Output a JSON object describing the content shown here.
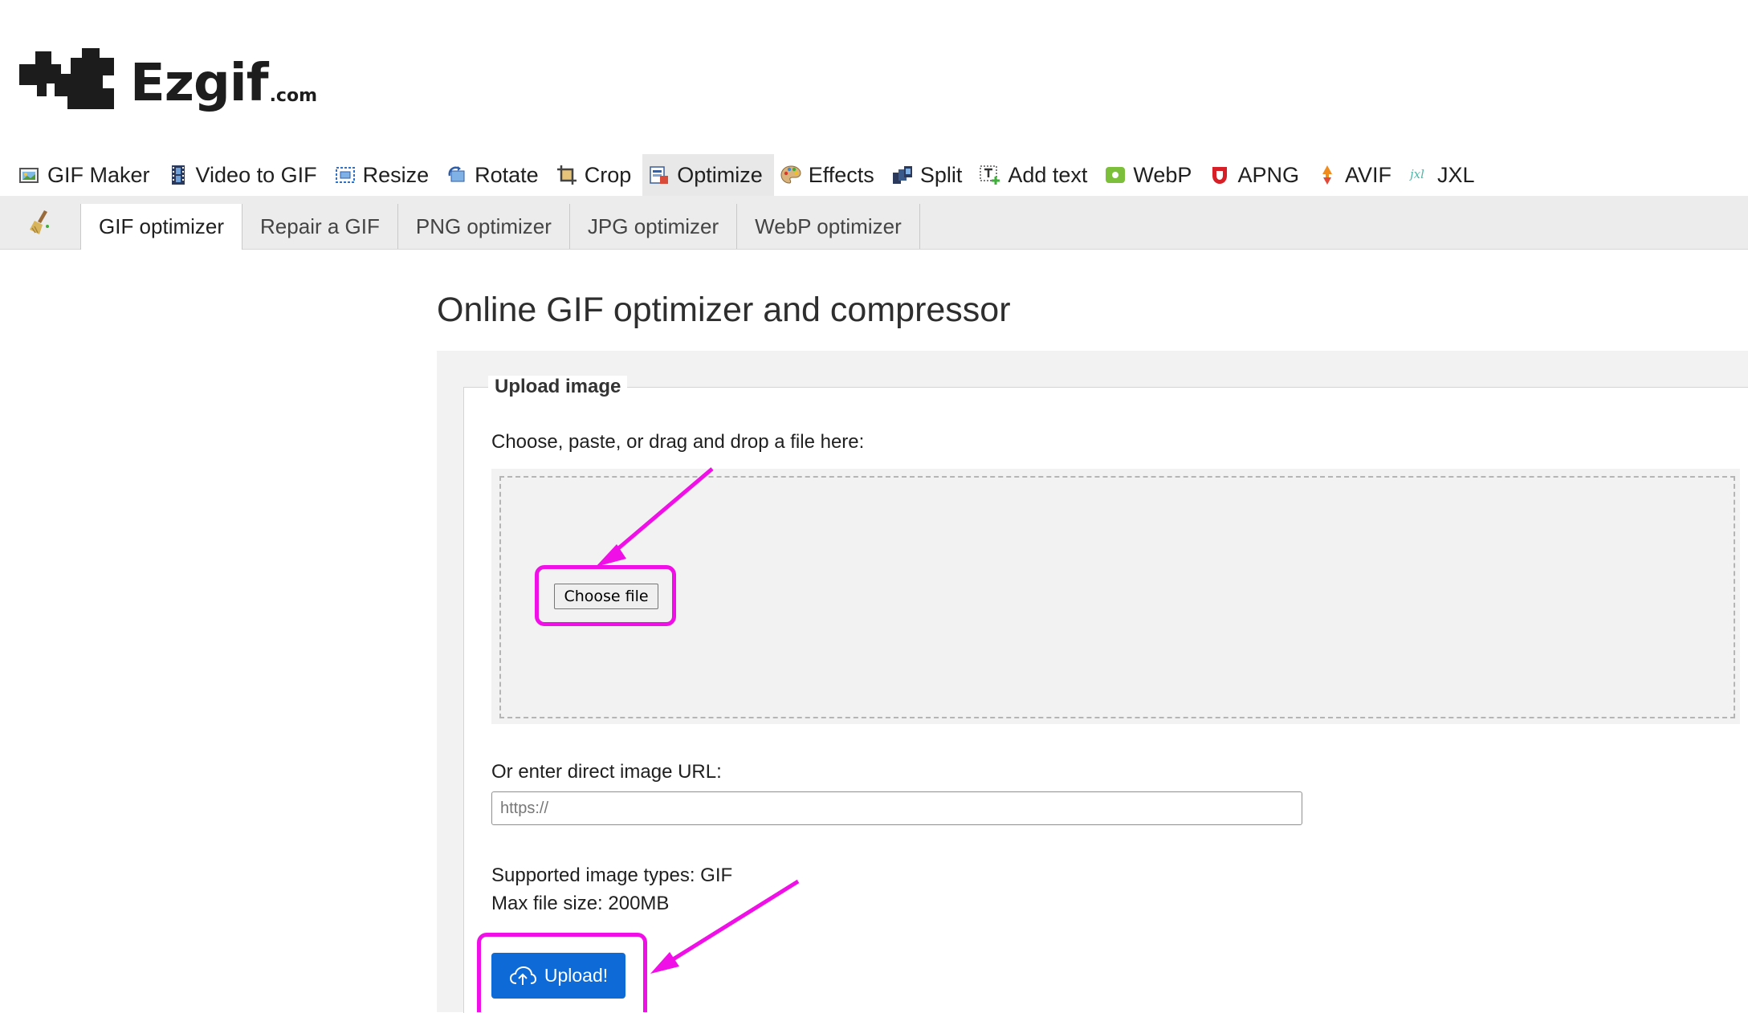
{
  "logo": {
    "name": "Ezgif",
    "tld": ".com"
  },
  "main_nav": [
    {
      "label": "GIF Maker",
      "icon": "gif-maker-icon",
      "active": false
    },
    {
      "label": "Video to GIF",
      "icon": "film-icon",
      "active": false
    },
    {
      "label": "Resize",
      "icon": "resize-icon",
      "active": false
    },
    {
      "label": "Rotate",
      "icon": "rotate-icon",
      "active": false
    },
    {
      "label": "Crop",
      "icon": "crop-icon",
      "active": false
    },
    {
      "label": "Optimize",
      "icon": "optimize-icon",
      "active": true
    },
    {
      "label": "Effects",
      "icon": "palette-icon",
      "active": false
    },
    {
      "label": "Split",
      "icon": "split-icon",
      "active": false
    },
    {
      "label": "Add text",
      "icon": "add-text-icon",
      "active": false
    },
    {
      "label": "WebP",
      "icon": "webp-icon",
      "active": false
    },
    {
      "label": "APNG",
      "icon": "apng-icon",
      "active": false
    },
    {
      "label": "AVIF",
      "icon": "avif-icon",
      "active": false
    },
    {
      "label": "JXL",
      "icon": "jxl-icon",
      "active": false
    }
  ],
  "sub_nav": [
    {
      "label": "GIF optimizer",
      "active": true
    },
    {
      "label": "Repair a GIF",
      "active": false
    },
    {
      "label": "PNG optimizer",
      "active": false
    },
    {
      "label": "JPG optimizer",
      "active": false
    },
    {
      "label": "WebP optimizer",
      "active": false
    }
  ],
  "page": {
    "title": "Online GIF optimizer and compressor",
    "legend": "Upload image",
    "drop_label": "Choose, paste, or drag and drop a file here:",
    "choose_file": "Choose file",
    "url_label": "Or enter direct image URL:",
    "url_placeholder": "https://",
    "supported": "Supported image types: GIF",
    "max_size": "Max file size: 200MB",
    "upload_button": "Upload!"
  },
  "colors": {
    "accent": "#0d6ad6",
    "annotation": "#f00fe6",
    "nav_active_bg": "#e8e8e8",
    "subnav_bg": "#ececec"
  }
}
